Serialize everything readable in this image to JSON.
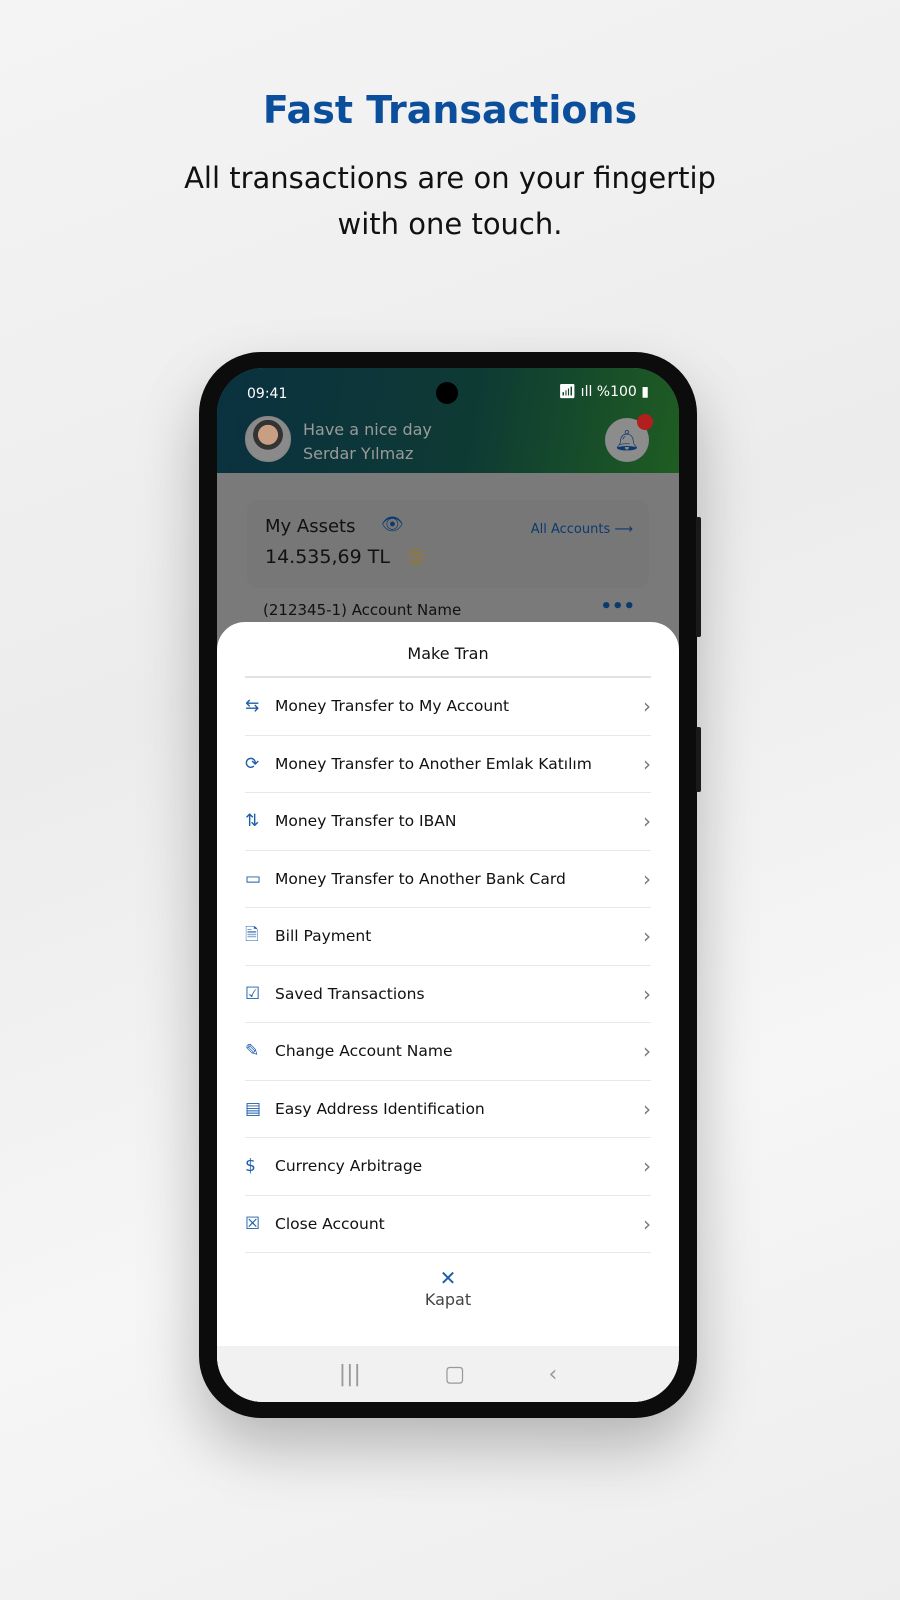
{
  "promo": {
    "title": "Fast Transactions",
    "subtitle_line1": "All transactions are on your fingertip",
    "subtitle_line2": "with one touch."
  },
  "status": {
    "time": "09:41",
    "battery": "%100"
  },
  "header": {
    "greeting": "Have a nice day",
    "user": "Serdar Yılmaz"
  },
  "assets": {
    "label": "My Assets",
    "value": "14.535,69 TL",
    "all_accounts": "All Accounts"
  },
  "account_row": "(212345-1)   Account Name",
  "sheet": {
    "title": "Make Tran",
    "items": [
      {
        "label": "Money Transfer to My Account",
        "icon": "⇆"
      },
      {
        "label": "Money Transfer to Another Emlak Katılım",
        "icon": "⟳"
      },
      {
        "label": "Money Transfer to IBAN",
        "icon": "⇅"
      },
      {
        "label": "Money Transfer to Another Bank Card",
        "icon": "▭"
      },
      {
        "label": "Bill Payment",
        "icon": "🗎"
      },
      {
        "label": "Saved Transactions",
        "icon": "☑"
      },
      {
        "label": "Change Account Name",
        "icon": "✎"
      },
      {
        "label": "Easy Address Identification",
        "icon": "▤"
      },
      {
        "label": "Currency Arbitrage",
        "icon": "$"
      },
      {
        "label": "Close Account",
        "icon": "☒"
      }
    ],
    "close_label": "Kapat"
  },
  "colors": {
    "accent": "#0b4f9c",
    "header_start": "#0a3140",
    "header_end": "#1f5d22"
  }
}
